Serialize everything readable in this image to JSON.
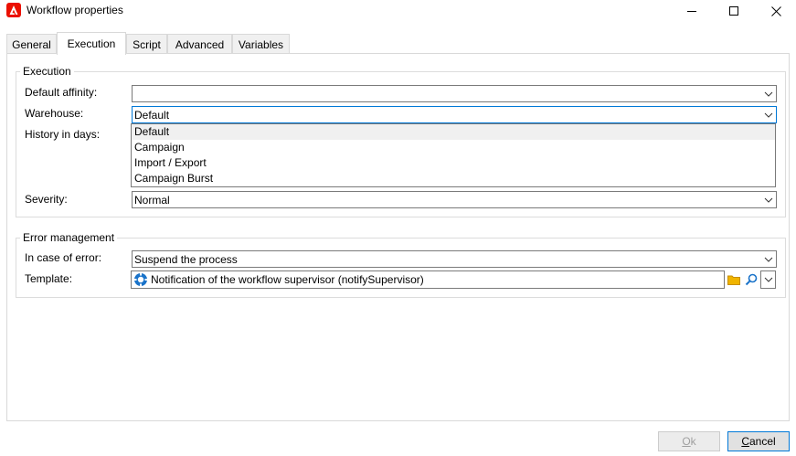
{
  "window": {
    "title": "Workflow properties"
  },
  "tabs": [
    {
      "label": "General"
    },
    {
      "label": "Execution"
    },
    {
      "label": "Script"
    },
    {
      "label": "Advanced"
    },
    {
      "label": "Variables"
    }
  ],
  "execution": {
    "legend": "Execution",
    "default_affinity": {
      "label": "Default affinity:",
      "value": ""
    },
    "warehouse": {
      "label": "Warehouse:",
      "value": "Default",
      "options": [
        "Default",
        "Campaign",
        "Import / Export",
        "Campaign Burst"
      ]
    },
    "history": {
      "label": "History in days:"
    },
    "severity": {
      "label": "Severity:",
      "value": "Normal"
    }
  },
  "error_management": {
    "legend": "Error management",
    "in_case_of_error": {
      "label": "In case of error:",
      "value": "Suspend the process"
    },
    "template": {
      "label": "Template:",
      "value": "Notification of the workflow supervisor (notifySupervisor)"
    }
  },
  "buttons": {
    "ok_mnemonic": "O",
    "ok_rest": "k",
    "cancel_mnemonic": "C",
    "cancel_rest": "ancel"
  },
  "colors": {
    "app_icon": "#eb1000",
    "focus_border": "#0078d7"
  },
  "icons": {
    "app": "adobe-campaign-icon",
    "template": "workflow-template-icon",
    "folder": "folder-icon",
    "search": "magnifier-icon"
  }
}
